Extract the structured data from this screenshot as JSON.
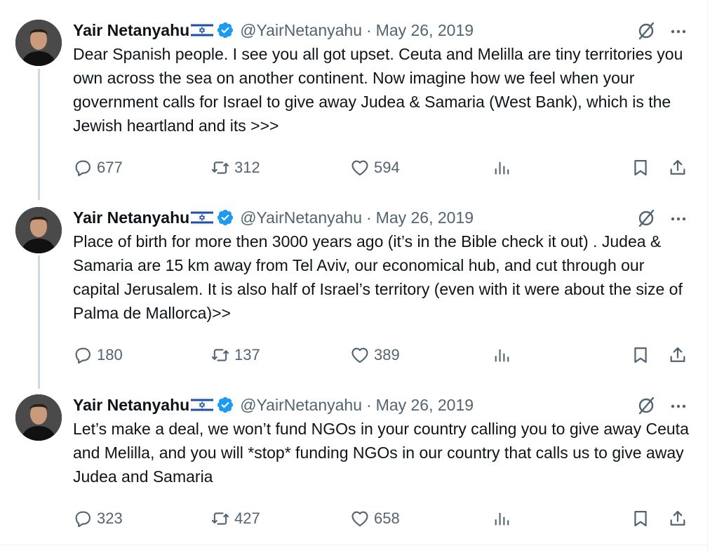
{
  "author": {
    "name": "Yair Netanyahu",
    "handle": "@YairNetanyahu",
    "flag_icon": "israel-flag-icon",
    "verified_icon": "verified-badge-icon",
    "verified_color": "#1d9bf0"
  },
  "colors": {
    "text": "#0f1419",
    "muted": "#536471",
    "thread_line": "#cfd9de",
    "accent": "#1d9bf0"
  },
  "tweets": [
    {
      "date": "May 26, 2019",
      "separator": "·",
      "text": "Dear Spanish people. I see you all got upset. Ceuta and Melilla are tiny territories you own across the sea on another continent. Now imagine how we feel when your government calls for Israel to give away Judea & Samaria (West Bank), which is the Jewish heartland and its >>>",
      "replies": "677",
      "reposts": "312",
      "likes": "594"
    },
    {
      "date": "May 26, 2019",
      "separator": "·",
      "text": "Place of birth for more then 3000 years ago (it’s in the Bible check it out) . Judea & Samaria are 15 km away from Tel Aviv, our economical hub, and cut through our capital Jerusalem. It is also half of Israel’s territory (even with it were about the size of Palma de Mallorca)>>",
      "replies": "180",
      "reposts": "137",
      "likes": "389"
    },
    {
      "date": "May 26, 2019",
      "separator": "·",
      "text": "Let’s make a deal, we won’t fund NGOs in your country calling you to give away Ceuta and Melilla, and you will *stop* funding NGOs in our country that calls us to give away Judea and Samaria",
      "replies": "323",
      "reposts": "427",
      "likes": "658"
    }
  ],
  "icons": [
    "grok-icon",
    "more-icon",
    "reply-icon",
    "repost-icon",
    "like-icon",
    "views-icon",
    "bookmark-icon",
    "share-icon"
  ]
}
